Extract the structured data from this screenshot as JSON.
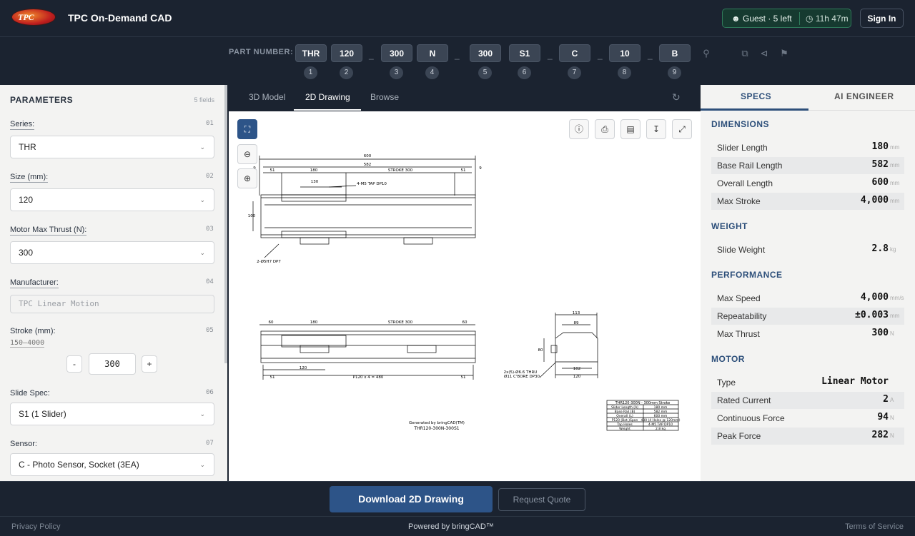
{
  "app": {
    "logo_text": "TPC",
    "title": "TPC On-Demand CAD"
  },
  "header": {
    "guest_label": "Guest · 5 left",
    "timer": "11h 47m",
    "signin": "Sign In"
  },
  "part_number": {
    "label": "PART NUMBER:",
    "segments": [
      "THR",
      "120",
      "300",
      "N",
      "300",
      "S1",
      "C",
      "10",
      "B"
    ],
    "indices": [
      "1",
      "2",
      "3",
      "4",
      "5",
      "6",
      "7",
      "8",
      "9"
    ],
    "separator": "_"
  },
  "params": {
    "title": "PARAMETERS",
    "count": "5 fields",
    "fields": [
      {
        "label": "Series:",
        "no": "01",
        "value": "THR"
      },
      {
        "label": "Size (mm):",
        "no": "02",
        "value": "120"
      },
      {
        "label": "Motor Max Thrust (N):",
        "no": "03",
        "value": "300"
      },
      {
        "label": "Manufacturer:",
        "no": "04",
        "value": "TPC Linear Motion"
      },
      {
        "label": "Stroke (mm):",
        "no": "05",
        "value": "300",
        "range": "150–4000",
        "minus": "-",
        "plus": "+"
      },
      {
        "label": "Slide Spec:",
        "no": "06",
        "value": "S1 (1 Slider)"
      },
      {
        "label": "Sensor:",
        "no": "07",
        "value": "C - Photo Sensor, Socket (3EA)"
      }
    ]
  },
  "viewer": {
    "tabs": [
      "3D Model",
      "2D Drawing",
      "Browse"
    ],
    "drawing": {
      "dims_top": [
        "600",
        "582",
        "51",
        "180",
        "STROKE 300",
        "51",
        "130",
        "4-M5 TAP DP10",
        "100",
        "2-Ø5H7 DP7",
        "9",
        "9"
      ],
      "dims_front": [
        "60",
        "180",
        "STROKE 300",
        "60",
        "51",
        "120",
        "P120 x 4 = 480",
        "51"
      ],
      "dims_side": [
        "113",
        "89",
        "80",
        "102",
        "120",
        "2x(5)-Ø6.6 THRU",
        "Ø11 C'BORE DP30"
      ],
      "generated": "Generated by bringCAD(TM)",
      "part": "THR120-300N-300S1",
      "table_title": "THR120-300N - 300mm Stroke",
      "table_rows": [
        [
          "Slider Length (A)",
          "180 mm"
        ],
        [
          "Base Rail (B)",
          "582 mm"
        ],
        [
          "Overall (L)",
          "600 mm"
        ],
        [
          "P120 (Bot.)Span",
          "480 (4 Holes @ 120mm)"
        ],
        [
          "Tap Holes",
          "4-M5 TAP DP10"
        ],
        [
          "Weight",
          "2.8 kg"
        ]
      ]
    }
  },
  "specs": {
    "tabs": [
      "SPECS",
      "AI ENGINEER"
    ],
    "sections": [
      {
        "title": "DIMENSIONS",
        "rows": [
          {
            "k": "Slider Length",
            "v": "180",
            "u": "mm"
          },
          {
            "k": "Base Rail Length",
            "v": "582",
            "u": "mm"
          },
          {
            "k": "Overall Length",
            "v": "600",
            "u": "mm"
          },
          {
            "k": "Max Stroke",
            "v": "4,000",
            "u": "mm"
          }
        ]
      },
      {
        "title": "WEIGHT",
        "rows": [
          {
            "k": "Slide Weight",
            "v": "2.8",
            "u": "kg"
          }
        ]
      },
      {
        "title": "PERFORMANCE",
        "rows": [
          {
            "k": "Max Speed",
            "v": "4,000",
            "u": "mm/s"
          },
          {
            "k": "Repeatability",
            "v": "±0.003",
            "u": "mm"
          },
          {
            "k": "Max Thrust",
            "v": "300",
            "u": "N"
          }
        ]
      },
      {
        "title": "MOTOR",
        "rows": [
          {
            "k": "Type",
            "v": "Linear Motor",
            "u": ""
          },
          {
            "k": "Rated Current",
            "v": "2",
            "u": "A"
          },
          {
            "k": "Continuous Force",
            "v": "94",
            "u": "N"
          },
          {
            "k": "Peak Force",
            "v": "282",
            "u": "N"
          }
        ]
      }
    ]
  },
  "actions": {
    "download": "Download 2D Drawing",
    "quote": "Request Quote"
  },
  "footer": {
    "privacy": "Privacy Policy",
    "powered": "Powered by bringCAD™",
    "terms": "Terms of Service"
  },
  "colors": {
    "accent": "#2d5488",
    "dark": "#1b2330",
    "guest_green": "#163a30"
  }
}
